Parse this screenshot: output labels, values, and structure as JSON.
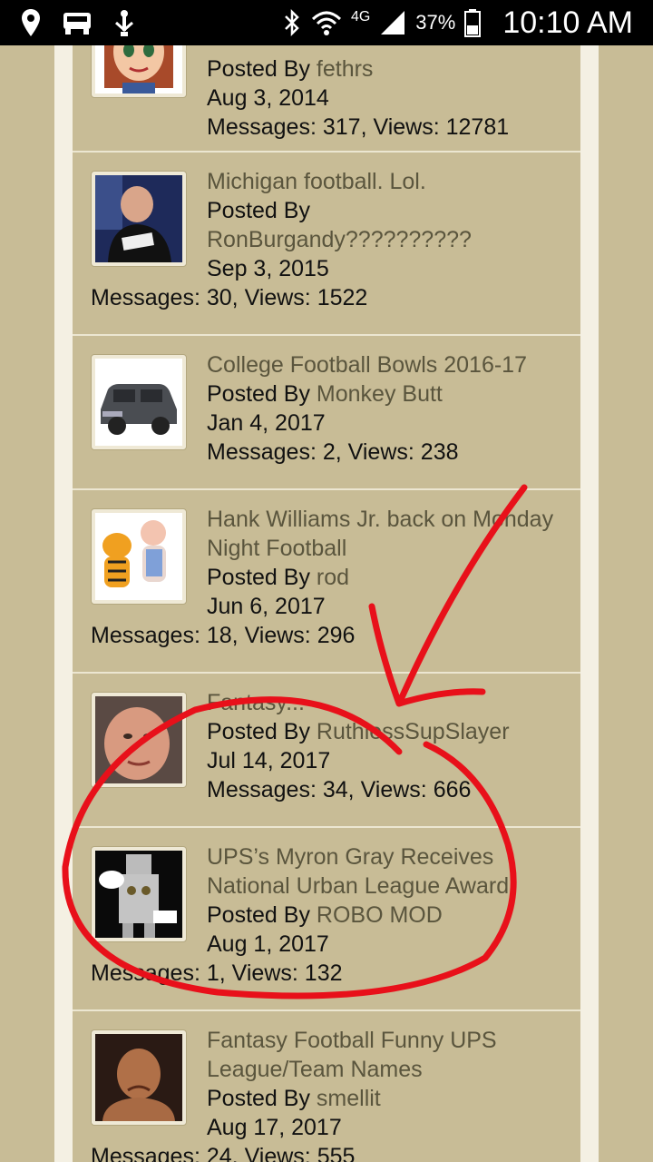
{
  "status_bar": {
    "network": "4G",
    "battery": "37%",
    "time": "10:10 AM"
  },
  "labels": {
    "posted_by": "Posted By",
    "messages": "Messages:",
    "views": "Views:"
  },
  "threads": [
    {
      "title": "",
      "author": "fethrs",
      "date": "Aug 3, 2014",
      "messages": "317",
      "views": "12781",
      "avatar": "cartoon-girl-avatar"
    },
    {
      "title": "Michigan football. Lol.",
      "author": "RonBurgandy??????????",
      "date": "Sep 3, 2015",
      "messages": "30",
      "views": "1522",
      "avatar": "wrestler-avatar"
    },
    {
      "title": "College Football Bowls 2016-17",
      "author": "Monkey Butt",
      "date": "Jan 4, 2017",
      "messages": "2",
      "views": "238",
      "avatar": "suv-truck-avatar"
    },
    {
      "title": "Hank Williams Jr. back on Monday Night Football",
      "author": "rod",
      "date": "Jun 6, 2017",
      "messages": "18",
      "views": "296",
      "avatar": "tiger-baby-avatar"
    },
    {
      "title": "Fantasy...",
      "author": "RuthlessSupSlayer",
      "date": "Jul 14, 2017",
      "messages": "34",
      "views": "666",
      "avatar": "face-avatar"
    },
    {
      "title": "UPS’s Myron Gray Receives National Urban League Award",
      "author": "ROBO MOD",
      "date": "Aug 1, 2017",
      "messages": "1",
      "views": "132",
      "avatar": "robot-avatar"
    },
    {
      "title": "Fantasy Football Funny UPS League/Team Names",
      "author": "smellit",
      "date": "Aug 17, 2017",
      "messages": "24",
      "views": "555",
      "avatar": "wrestler-face-avatar"
    }
  ],
  "colors": {
    "background": "#c8bc96",
    "link": "#5a553d",
    "annotation": "#e8101a"
  }
}
